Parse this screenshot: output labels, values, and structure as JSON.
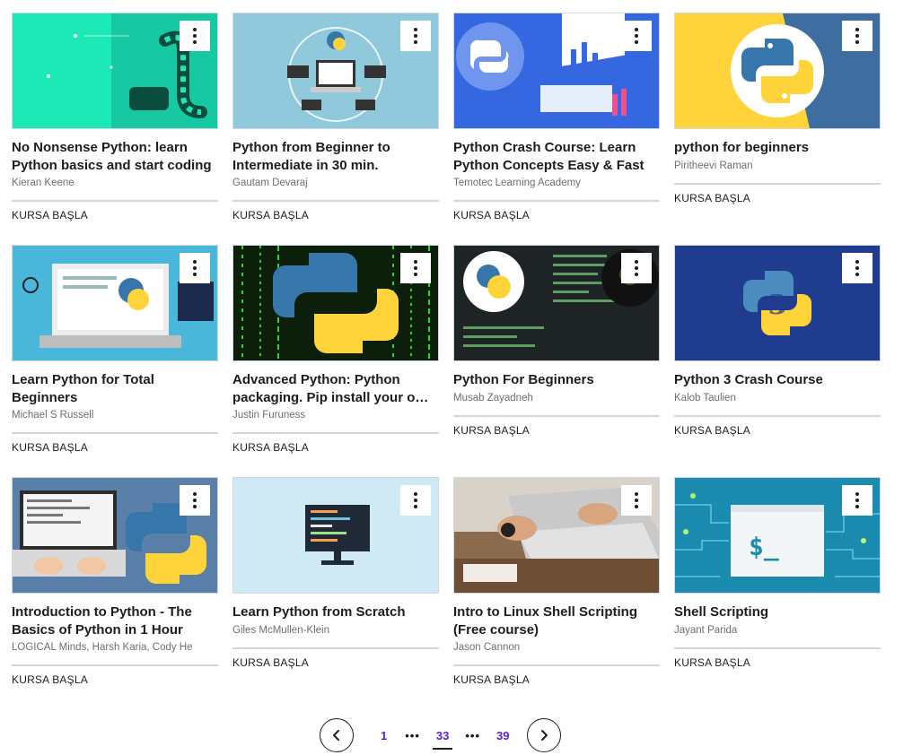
{
  "courses": [
    {
      "title": "No Nonsense Python: learn Python basics and start coding",
      "author": "Kieran Keene",
      "cta": "KURSA BAŞLA"
    },
    {
      "title": "Python from Beginner to Intermediate in 30 min.",
      "author": "Gautam Devaraj",
      "cta": "KURSA BAŞLA"
    },
    {
      "title": "Python Crash Course: Learn Python Concepts Easy & Fast",
      "author": "Temotec Learning Academy",
      "cta": "KURSA BAŞLA"
    },
    {
      "title": "python for beginners",
      "author": "Piritheevi Raman",
      "cta": "KURSA BAŞLA"
    },
    {
      "title": "Learn Python for Total Beginners",
      "author": "Michael S Russell",
      "cta": "KURSA BAŞLA"
    },
    {
      "title": "Advanced Python: Python packaging. Pip install your own code",
      "author": "Justin Furuness",
      "cta": "KURSA BAŞLA"
    },
    {
      "title": "Python For Beginners",
      "author": "Musab Zayadneh",
      "cta": "KURSA BAŞLA"
    },
    {
      "title": "Python 3 Crash Course",
      "author": "Kalob Taulien",
      "cta": "KURSA BAŞLA"
    },
    {
      "title": "Introduction to Python - The Basics of Python in 1 Hour",
      "author": "LOGICAL Minds, Harsh Karia, Cody He",
      "cta": "KURSA BAŞLA"
    },
    {
      "title": "Learn Python from Scratch",
      "author": "Giles McMullen-Klein",
      "cta": "KURSA BAŞLA"
    },
    {
      "title": "Intro to Linux Shell Scripting (Free course)",
      "author": "Jason Cannon",
      "cta": "KURSA BAŞLA"
    },
    {
      "title": "Shell Scripting",
      "author": "Jayant Parida",
      "cta": "KURSA BAŞLA"
    }
  ],
  "thumb_icons": [
    "python-snake-illustration",
    "laptop-network-illustration",
    "python-dashboard-illustration",
    "python-logo",
    "laptop-python-illustration",
    "python-matrix-illustration",
    "python-code-screen-illustration",
    "python-3-logo",
    "laptop-python-illustration",
    "monitor-code-illustration",
    "laptop-typing-photo",
    "terminal-circuit-illustration"
  ],
  "pagination": {
    "prev_icon": "chevron-left-icon",
    "next_icon": "chevron-right-icon",
    "first": "1",
    "ellipsis": "•••",
    "current": "33",
    "last": "39"
  },
  "colors": {
    "link": "#5624d0",
    "text": "#1c1d1f",
    "muted": "#6a6f73",
    "divider": "#d1d7dc"
  }
}
